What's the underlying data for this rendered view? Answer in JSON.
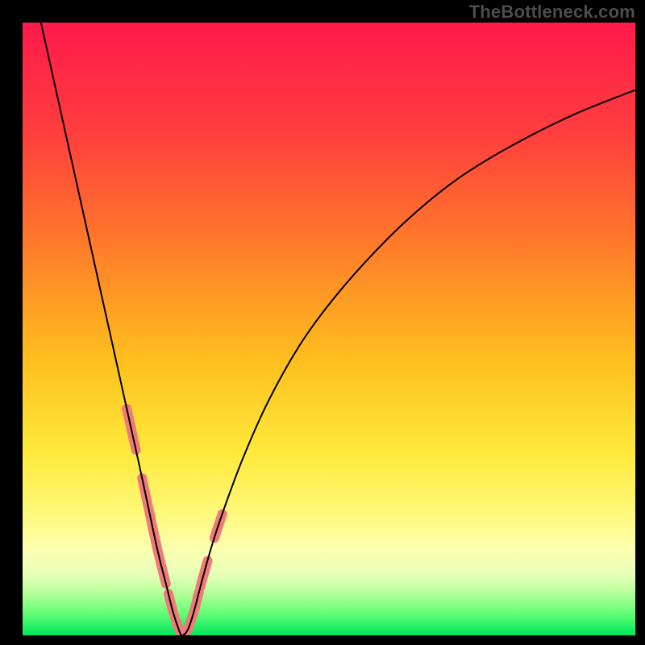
{
  "watermark": "TheBottleneck.com",
  "chart_data": {
    "type": "line",
    "title": "",
    "xlabel": "",
    "ylabel": "",
    "xlim": [
      0,
      100
    ],
    "ylim": [
      0,
      100
    ],
    "grid": false,
    "legend": false,
    "background_gradient_stops": [
      {
        "pct": 0,
        "color": "#ff1a4b"
      },
      {
        "pct": 18,
        "color": "#ff3e3d"
      },
      {
        "pct": 36,
        "color": "#ff7a2a"
      },
      {
        "pct": 55,
        "color": "#ffbf1e"
      },
      {
        "pct": 70,
        "color": "#ffe93a"
      },
      {
        "pct": 80,
        "color": "#fff97a"
      },
      {
        "pct": 86,
        "color": "#fcffb0"
      },
      {
        "pct": 90,
        "color": "#e8ffb8"
      },
      {
        "pct": 93,
        "color": "#b8ff9c"
      },
      {
        "pct": 96,
        "color": "#6fff7a"
      },
      {
        "pct": 100,
        "color": "#00e85c"
      }
    ],
    "series": [
      {
        "name": "bottleneck-curve",
        "color": "#000000",
        "x": [
          3,
          5,
          7,
          9,
          11,
          13,
          15,
          17,
          19,
          20.5,
          22,
          23.5,
          24.5,
          25.3,
          26,
          27,
          28,
          29.3,
          31,
          33,
          36,
          40,
          45,
          50,
          56,
          63,
          71,
          80,
          90,
          100
        ],
        "y": [
          100,
          91,
          82,
          73,
          64,
          55,
          46,
          37,
          28,
          21,
          14,
          8,
          4,
          1.5,
          0,
          1,
          4,
          9,
          15,
          21,
          29,
          38,
          47,
          54,
          61,
          68,
          74.5,
          80,
          85,
          89
        ]
      }
    ],
    "highlight_segments": {
      "name": "fit-region-markers",
      "color": "#ef7a7a",
      "stroke_width": 12,
      "ranges_x": [
        [
          17.0,
          18.5
        ],
        [
          19.5,
          23.4
        ],
        [
          23.8,
          24.8
        ],
        [
          25.0,
          28.8
        ],
        [
          29.0,
          30.2
        ],
        [
          31.3,
          32.6
        ]
      ]
    }
  }
}
